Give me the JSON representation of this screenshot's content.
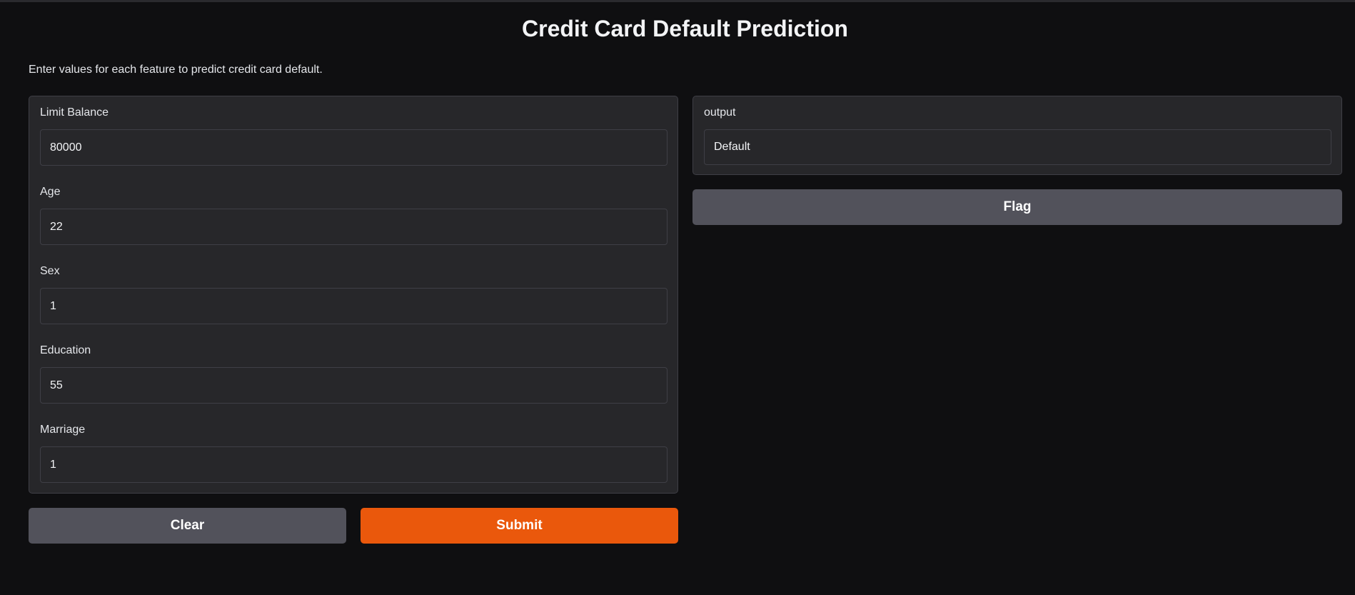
{
  "header": {
    "title": "Credit Card Default Prediction",
    "description": "Enter values for each feature to predict credit card default."
  },
  "inputs": {
    "fields": [
      {
        "label": "Limit Balance",
        "value": "80000"
      },
      {
        "label": "Age",
        "value": "22"
      },
      {
        "label": "Sex",
        "value": "1"
      },
      {
        "label": "Education",
        "value": "55"
      },
      {
        "label": "Marriage",
        "value": "1"
      }
    ]
  },
  "actions": {
    "clear_label": "Clear",
    "submit_label": "Submit",
    "flag_label": "Flag"
  },
  "output": {
    "label": "output",
    "value": "Default"
  },
  "colors": {
    "background": "#0f0f11",
    "panel": "#27272a",
    "primary": "#ea580c",
    "secondary": "#52525b"
  }
}
